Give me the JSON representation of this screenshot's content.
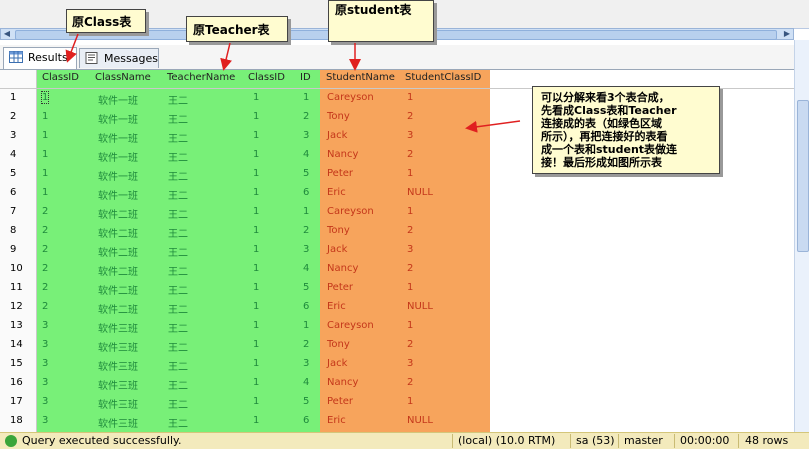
{
  "annotations": {
    "class_label": "原Class表",
    "teacher_label": "原Teacher表",
    "student_label": "原student表",
    "note_lines": [
      "可以分解来看3个表合成，",
      "先看成Class表和Teacher",
      "连接成的表（如绿色区域",
      "所示），再把连接好的表看",
      "成一个表和student表做连",
      "接！最后形成如图所示表"
    ]
  },
  "tabs": [
    {
      "label": "Results",
      "icon": "grid-icon",
      "active": true
    },
    {
      "label": "Messages",
      "icon": "messages-icon",
      "active": false
    }
  ],
  "columns": [
    "ClassID",
    "ClassName",
    "TeacherName",
    "ClassID",
    "ID",
    "StudentName",
    "StudentClassID"
  ],
  "rows": [
    {
      "n": "1",
      "cells": [
        "1",
        "软件一班",
        "王二",
        "1",
        "1",
        "Careyson",
        "1"
      ]
    },
    {
      "n": "2",
      "cells": [
        "1",
        "软件一班",
        "王二",
        "1",
        "2",
        "Tony",
        "2"
      ]
    },
    {
      "n": "3",
      "cells": [
        "1",
        "软件一班",
        "王二",
        "1",
        "3",
        "Jack",
        "3"
      ]
    },
    {
      "n": "4",
      "cells": [
        "1",
        "软件一班",
        "王二",
        "1",
        "4",
        "Nancy",
        "2"
      ]
    },
    {
      "n": "5",
      "cells": [
        "1",
        "软件一班",
        "王二",
        "1",
        "5",
        "Peter",
        "1"
      ]
    },
    {
      "n": "6",
      "cells": [
        "1",
        "软件一班",
        "王二",
        "1",
        "6",
        "Eric",
        "NULL"
      ]
    },
    {
      "n": "7",
      "cells": [
        "2",
        "软件二班",
        "王二",
        "1",
        "1",
        "Careyson",
        "1"
      ]
    },
    {
      "n": "8",
      "cells": [
        "2",
        "软件二班",
        "王二",
        "1",
        "2",
        "Tony",
        "2"
      ]
    },
    {
      "n": "9",
      "cells": [
        "2",
        "软件二班",
        "王二",
        "1",
        "3",
        "Jack",
        "3"
      ]
    },
    {
      "n": "10",
      "cells": [
        "2",
        "软件二班",
        "王二",
        "1",
        "4",
        "Nancy",
        "2"
      ]
    },
    {
      "n": "11",
      "cells": [
        "2",
        "软件二班",
        "王二",
        "1",
        "5",
        "Peter",
        "1"
      ]
    },
    {
      "n": "12",
      "cells": [
        "2",
        "软件二班",
        "王二",
        "1",
        "6",
        "Eric",
        "NULL"
      ]
    },
    {
      "n": "13",
      "cells": [
        "3",
        "软件三班",
        "王二",
        "1",
        "1",
        "Careyson",
        "1"
      ]
    },
    {
      "n": "14",
      "cells": [
        "3",
        "软件三班",
        "王二",
        "1",
        "2",
        "Tony",
        "2"
      ]
    },
    {
      "n": "15",
      "cells": [
        "3",
        "软件三班",
        "王二",
        "1",
        "3",
        "Jack",
        "3"
      ]
    },
    {
      "n": "16",
      "cells": [
        "3",
        "软件三班",
        "王二",
        "1",
        "4",
        "Nancy",
        "2"
      ]
    },
    {
      "n": "17",
      "cells": [
        "3",
        "软件三班",
        "王二",
        "1",
        "5",
        "Peter",
        "1"
      ]
    },
    {
      "n": "18",
      "cells": [
        "3",
        "软件三班",
        "王二",
        "1",
        "6",
        "Eric",
        "NULL"
      ]
    }
  ],
  "status": {
    "message": "Query executed successfully.",
    "server": "(local) (10.0 RTM)",
    "user": "sa (53)",
    "database": "master",
    "elapsed": "00:00:00",
    "row_count": "48 rows"
  },
  "colors": {
    "join_region": "#78f078",
    "student_region": "#f7a45c",
    "arrow": "#e02020"
  }
}
